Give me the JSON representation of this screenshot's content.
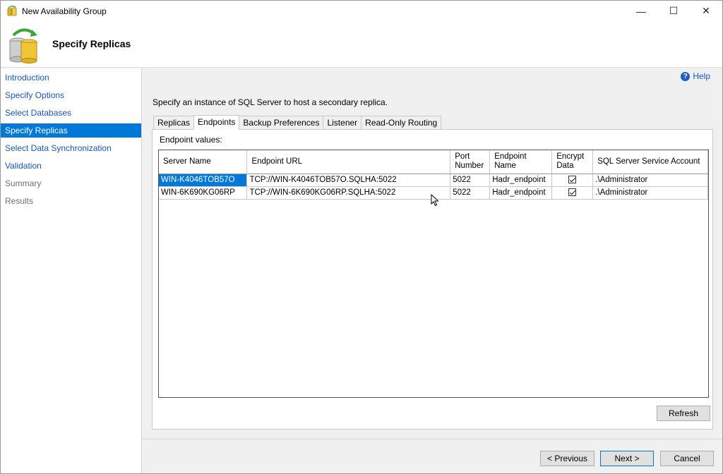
{
  "window": {
    "title": "New Availability Group",
    "controls": {
      "minimize": "—",
      "maximize": "☐",
      "close": "✕"
    }
  },
  "header": {
    "title": "Specify Replicas"
  },
  "sidebar": {
    "items": [
      {
        "label": "Introduction",
        "state": "normal"
      },
      {
        "label": "Specify Options",
        "state": "normal"
      },
      {
        "label": "Select Databases",
        "state": "normal"
      },
      {
        "label": "Specify Replicas",
        "state": "selected"
      },
      {
        "label": "Select Data Synchronization",
        "state": "normal"
      },
      {
        "label": "Validation",
        "state": "normal"
      },
      {
        "label": "Summary",
        "state": "disabled"
      },
      {
        "label": "Results",
        "state": "disabled"
      }
    ]
  },
  "main": {
    "help_label": "Help",
    "instruction": "Specify an instance of SQL Server to host a secondary replica.",
    "tabs": [
      {
        "label": "Replicas",
        "active": false
      },
      {
        "label": "Endpoints",
        "active": true
      },
      {
        "label": "Backup Preferences",
        "active": false
      },
      {
        "label": "Listener",
        "active": false
      },
      {
        "label": "Read-Only Routing",
        "active": false
      }
    ],
    "panel_label": "Endpoint values:",
    "table": {
      "headers": {
        "server_name": "Server Name",
        "endpoint_url": "Endpoint URL",
        "port_number": "Port Number",
        "endpoint_name": "Endpoint Name",
        "encrypt_data": "Encrypt Data",
        "service_account": "SQL Server Service Account"
      },
      "rows": [
        {
          "server_name": "WIN-K4046TOB57O",
          "endpoint_url": "TCP://WIN-K4046TOB57O.SQLHA:5022",
          "port_number": "5022",
          "endpoint_name": "Hadr_endpoint",
          "encrypt_data": true,
          "service_account": ".\\Administrator"
        },
        {
          "server_name": "WIN-6K690KG06RP",
          "endpoint_url": "TCP://WIN-6K690KG06RP.SQLHA:5022",
          "port_number": "5022",
          "endpoint_name": "Hadr_endpoint",
          "encrypt_data": true,
          "service_account": ".\\Administrator"
        }
      ]
    },
    "refresh_label": "Refresh"
  },
  "footer": {
    "previous_label": "< Previous",
    "next_label": "Next >",
    "cancel_label": "Cancel"
  },
  "colors": {
    "selection": "#0078d7",
    "link": "#1a56b6",
    "window_bg": "#f0f0f0"
  }
}
